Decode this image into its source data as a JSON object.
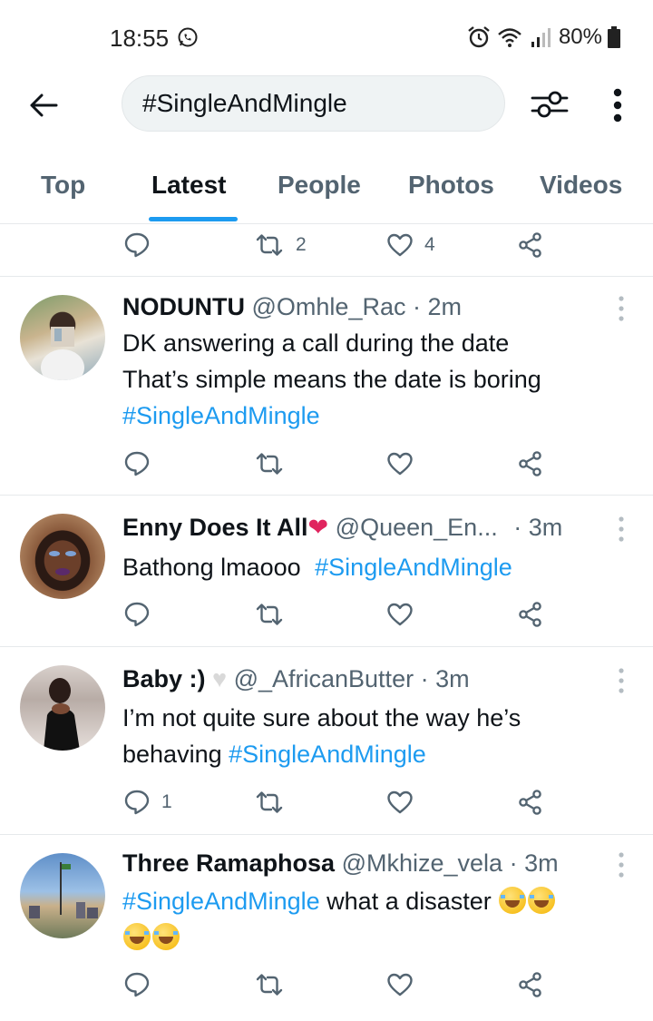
{
  "status_bar": {
    "time": "18:55",
    "battery": "80%"
  },
  "header": {
    "search_query": "#SingleAndMingle"
  },
  "tabs": [
    {
      "label": "Top"
    },
    {
      "label": "Latest"
    },
    {
      "label": "People"
    },
    {
      "label": "Photos"
    },
    {
      "label": "Videos"
    }
  ],
  "active_tab": "Latest",
  "top_partial_tweet": {
    "retweets": "2",
    "likes": "4"
  },
  "tweets": [
    {
      "name": "NODUNTU",
      "handle": "@Omhle_Rac",
      "time": "· 2m",
      "line1": "DK answering a call during the date",
      "line2": "That’s simple means the date is boring",
      "hashtag": "#SingleAndMingle"
    },
    {
      "name": "Enny Does It All",
      "handle": "@Queen_En...",
      "time": "· 3m",
      "text": "Bathong lmaooo ",
      "hashtag": "#SingleAndMingle"
    },
    {
      "name": "Baby :)",
      "handle": "@_AfricanButter",
      "time": "· 3m",
      "line1": "I’m not quite sure about the way he’s",
      "line2_prefix": "behaving ",
      "hashtag": "#SingleAndMingle",
      "replies": "1"
    },
    {
      "name": "Three Ramaphosa",
      "handle": "@Mkhize_vela",
      "time": "· 3m",
      "hashtag": "#SingleAndMingle",
      "text": " what a disaster "
    }
  ],
  "colors": {
    "accent": "#1d9bf0",
    "text_primary": "#0f1419",
    "text_secondary": "#536471"
  }
}
